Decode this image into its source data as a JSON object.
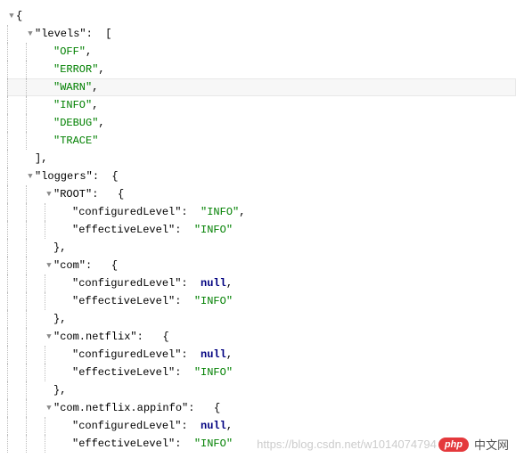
{
  "punct": {
    "lbrace": "{",
    "rbrace": "}",
    "lbracket": "[",
    "rbracket": "]",
    "comma": ",",
    "colon": ": ",
    "rbrace_comma": "},"
  },
  "keys": {
    "levels": "\"levels\"",
    "loggers": "\"loggers\"",
    "root": "\"ROOT\"",
    "com": "\"com\"",
    "netflix": "\"com.netflix\"",
    "appinfo": "\"com.netflix.appinfo\"",
    "configured": "\"configuredLevel\"",
    "effective": "\"effectiveLevel\""
  },
  "levels": {
    "off": "\"OFF\"",
    "error": "\"ERROR\"",
    "warn": "\"WARN\"",
    "info": "\"INFO\"",
    "debug": "\"DEBUG\"",
    "trace": "\"TRACE\""
  },
  "values": {
    "info": "\"INFO\"",
    "null": "null"
  },
  "toggle": "▼",
  "watermark": {
    "url": "https://blog.csdn.net/w1014074794",
    "badge": "php",
    "cn": "中文网"
  }
}
